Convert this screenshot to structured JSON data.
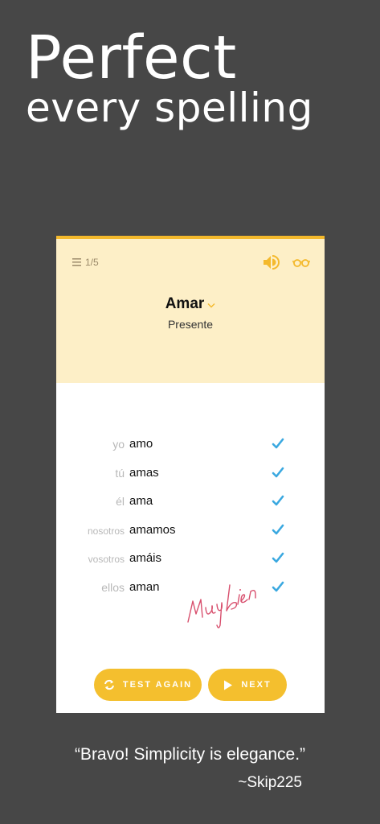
{
  "headline": {
    "line1": "Perfect",
    "line2": "every spelling"
  },
  "card": {
    "progress": "1/5",
    "verb": "Amar",
    "tense": "Presente",
    "rows": [
      {
        "pronoun": "yo",
        "form": "amo"
      },
      {
        "pronoun": "tú",
        "form": "amas"
      },
      {
        "pronoun": "él",
        "form": "ama"
      },
      {
        "pronoun": "nosotros",
        "form": "amamos"
      },
      {
        "pronoun": "vosotros",
        "form": "amáis"
      },
      {
        "pronoun": "ellos",
        "form": "aman"
      }
    ],
    "signature": "Muy bien",
    "buttons": {
      "test_again": "TEST AGAIN",
      "next": "NEXT"
    }
  },
  "quote": "“Bravo! Simplicity is elegance.”",
  "author": "~Skip225",
  "colors": {
    "background": "#474747",
    "accent": "#f4bf2e",
    "header": "#fdefc7",
    "check": "#3aa8e0",
    "signature": "#d8506e"
  },
  "icons": [
    "menu-icon",
    "speaker-icon",
    "glasses-icon",
    "chevron-down-icon",
    "check-icon",
    "refresh-icon",
    "play-icon"
  ]
}
